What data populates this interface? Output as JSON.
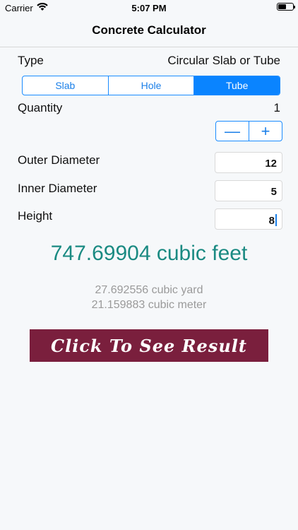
{
  "status_bar": {
    "carrier": "Carrier",
    "time": "5:07 PM"
  },
  "nav": {
    "title": "Concrete Calculator"
  },
  "type_row": {
    "label": "Type",
    "value": "Circular Slab or Tube"
  },
  "segments": [
    {
      "label": "Slab",
      "active": false
    },
    {
      "label": "Hole",
      "active": false
    },
    {
      "label": "Tube",
      "active": true
    }
  ],
  "quantity": {
    "label": "Quantity",
    "value": "1",
    "minus_symbol": "—",
    "plus_symbol": "+"
  },
  "fields": [
    {
      "label": "Outer Diameter",
      "value": "12"
    },
    {
      "label": "Inner Diameter",
      "value": "5"
    },
    {
      "label": "Height",
      "value": "8"
    }
  ],
  "results": {
    "main": "747.69904 cubic feet",
    "cubic_yard": "27.692556 cubic yard",
    "cubic_meter": "21.159883 cubic meter"
  },
  "cta": {
    "label": "Click To See Result"
  },
  "colors": {
    "accent": "#0a84ff",
    "result": "#1a8a82",
    "cta_bg": "#7a1f3d"
  }
}
